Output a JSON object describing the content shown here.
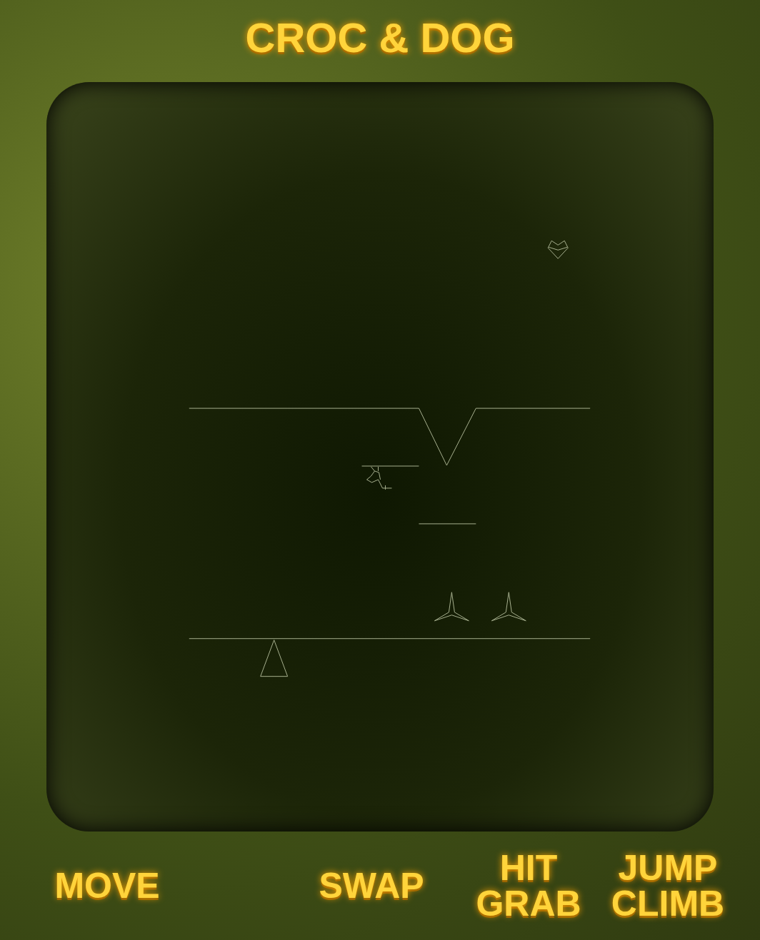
{
  "title": "CROC & DOG",
  "controls": [
    {
      "lines": [
        "MOVE"
      ]
    },
    {
      "lines": [
        "SWAP"
      ]
    },
    {
      "lines": [
        "HIT",
        "GRAB"
      ]
    },
    {
      "lines": [
        "JUMP",
        "CLIMB"
      ]
    }
  ]
}
